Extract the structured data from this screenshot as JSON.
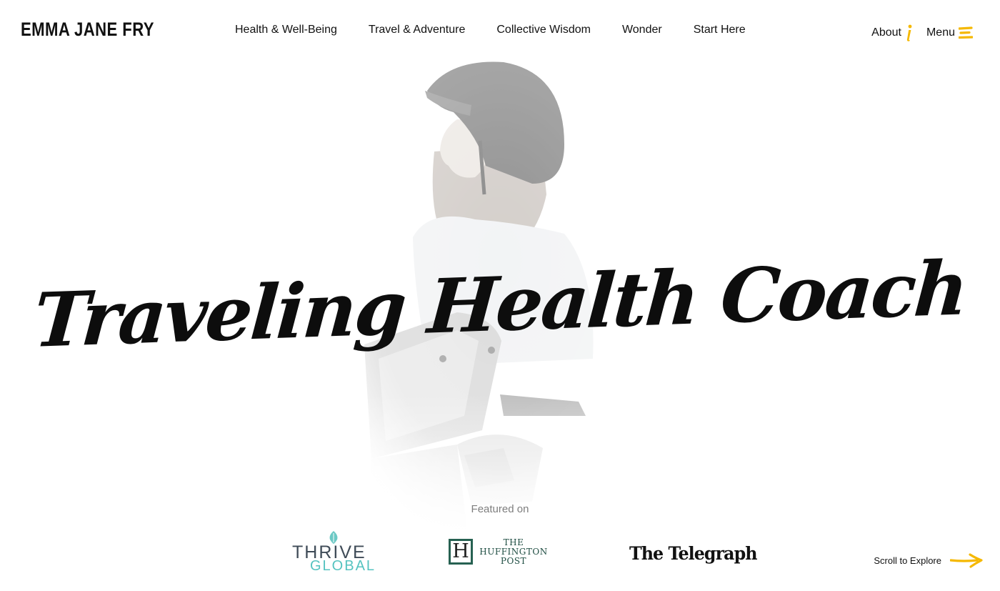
{
  "header": {
    "logo_text": "EMMA JANE FRY",
    "nav": [
      {
        "label": "Health & Well-Being"
      },
      {
        "label": "Travel & Adventure"
      },
      {
        "label": "Collective Wisdom"
      },
      {
        "label": "Wonder"
      },
      {
        "label": "Start Here"
      }
    ],
    "about_label": "About",
    "about_icon": "info-icon",
    "menu_label": "Menu",
    "menu_icon": "hamburger-icon"
  },
  "hero": {
    "title": "Traveling Health Coach",
    "photo": "woman-on-motorbike-photo"
  },
  "featured": {
    "label": "Featured on",
    "logos": {
      "thrive_line1": "THRIVE",
      "thrive_line2": "GLOBAL",
      "huffington_initial": "H",
      "huffington_line1": "THE",
      "huffington_line2": "HUFFINGTON",
      "huffington_line3": "POST",
      "telegraph": "The Telegraph"
    }
  },
  "scroll": {
    "label": "Scroll to Explore",
    "icon": "arrow-right-icon"
  },
  "colors": {
    "accent": "#f5b800",
    "text": "#111111",
    "muted": "#7d7d7d",
    "thrive_teal": "#55c3c0",
    "huffington_green": "#276152"
  }
}
